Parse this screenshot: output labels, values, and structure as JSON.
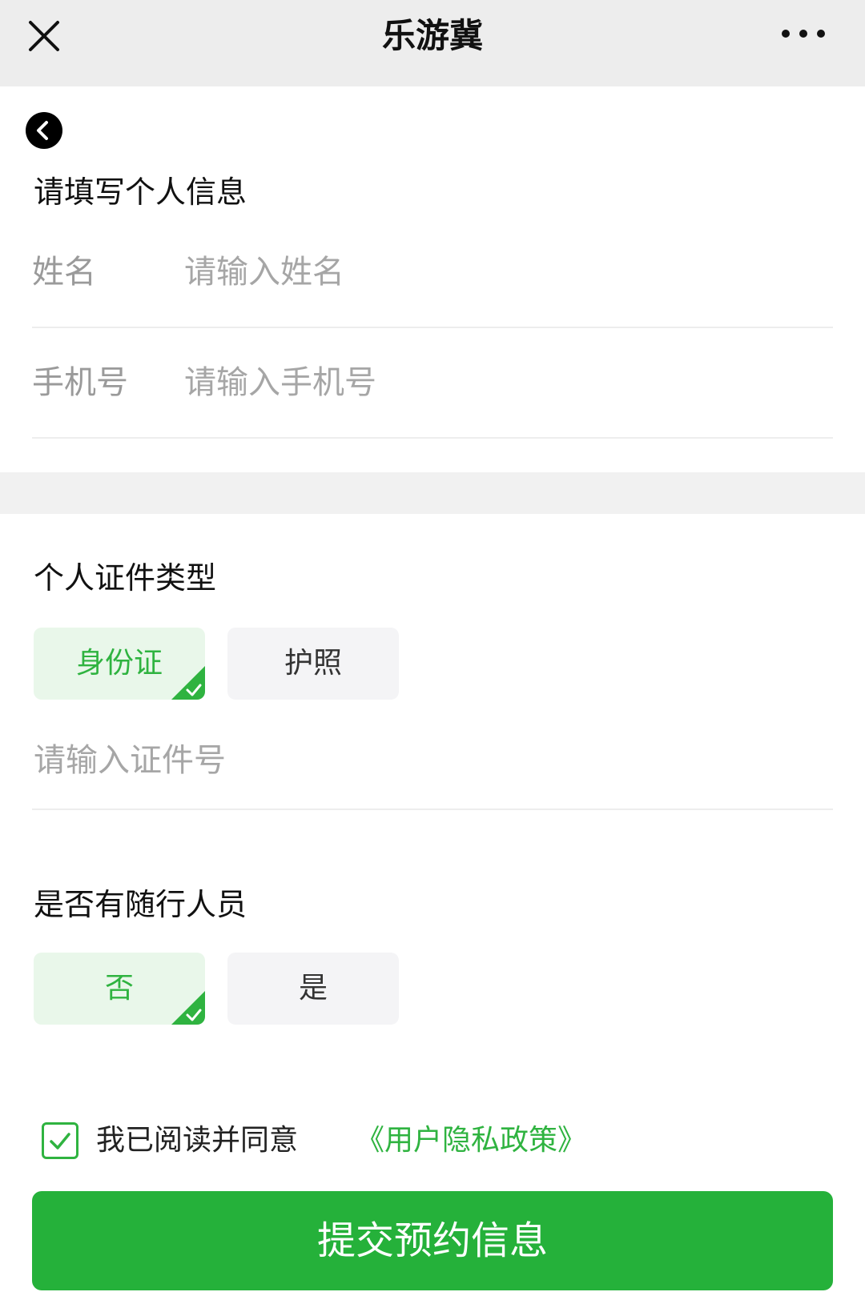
{
  "nav": {
    "title": "乐游冀",
    "close_icon": "close-icon",
    "more_icon": "more-dots-icon"
  },
  "back_icon": "chevron-left-icon",
  "personal_info": {
    "title": "请填写个人信息",
    "name": {
      "label": "姓名",
      "placeholder": "请输入姓名",
      "value": ""
    },
    "phone": {
      "label": "手机号",
      "placeholder": "请输入手机号",
      "value": ""
    }
  },
  "id_type": {
    "title": "个人证件类型",
    "options": [
      "身份证",
      "护照"
    ],
    "selected": "身份证",
    "id_placeholder": "请输入证件号"
  },
  "companion": {
    "title": "是否有随行人员",
    "options": [
      "否",
      "是"
    ],
    "selected": "否"
  },
  "agreement": {
    "checked": true,
    "text": "我已阅读并同意",
    "link": "《用户隐私政策》"
  },
  "submit_label": "提交预约信息",
  "colors": {
    "accent": "#2fb340",
    "submit_bg": "#25b13a",
    "chip_selected_bg": "#e9f7ea",
    "chip_bg": "#f4f4f6",
    "nav_bg": "#ededed"
  }
}
